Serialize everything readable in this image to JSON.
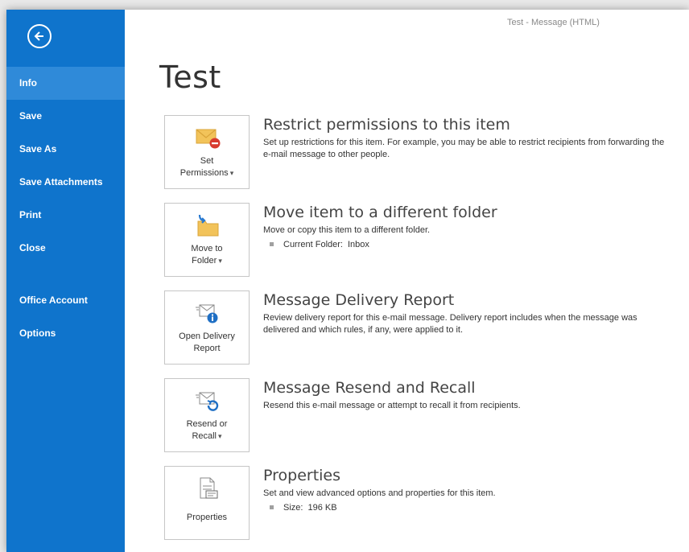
{
  "window": {
    "title": "Test - Message (HTML)"
  },
  "sidebar": {
    "items": [
      {
        "label": "Info"
      },
      {
        "label": "Save"
      },
      {
        "label": "Save As"
      },
      {
        "label": "Save Attachments"
      },
      {
        "label": "Print"
      },
      {
        "label": "Close"
      },
      {
        "label": "Office Account"
      },
      {
        "label": "Options"
      }
    ]
  },
  "page": {
    "title": "Test"
  },
  "sections": [
    {
      "tile_line1": "Set",
      "tile_line2": "Permissions",
      "heading": "Restrict permissions to this item",
      "description": "Set up restrictions for this item. For example, you may be able to restrict recipients from forwarding the e-mail message to other people."
    },
    {
      "tile_line1": "Move to",
      "tile_line2": "Folder",
      "heading": "Move item to a different folder",
      "description": "Move or copy this item to a different folder.",
      "meta_label": "Current Folder:",
      "meta_value": "Inbox"
    },
    {
      "tile_line1": "Open Delivery",
      "tile_line2": "Report",
      "heading": "Message Delivery Report",
      "description": "Review delivery report for this e-mail message. Delivery report includes when the message was delivered and which rules, if any, were applied to it."
    },
    {
      "tile_line1": "Resend or",
      "tile_line2": "Recall",
      "heading": "Message Resend and Recall",
      "description": "Resend this e-mail message or attempt to recall it from recipients."
    },
    {
      "tile_line1": "Properties",
      "heading": "Properties",
      "description": "Set and view advanced options and properties for this item.",
      "meta_label": "Size:",
      "meta_value": "196 KB"
    }
  ],
  "icons": {
    "back": "back-arrow-icon",
    "permissions": "envelope-restricted-icon",
    "move": "folder-move-icon",
    "delivery": "delivery-report-icon",
    "resend": "resend-recall-icon",
    "properties": "properties-document-icon"
  },
  "colors": {
    "sidebar_bg": "#0f74cc",
    "sidebar_active": "#2f8ad9",
    "text": "#333333",
    "tile_border": "#c6c6c6"
  }
}
